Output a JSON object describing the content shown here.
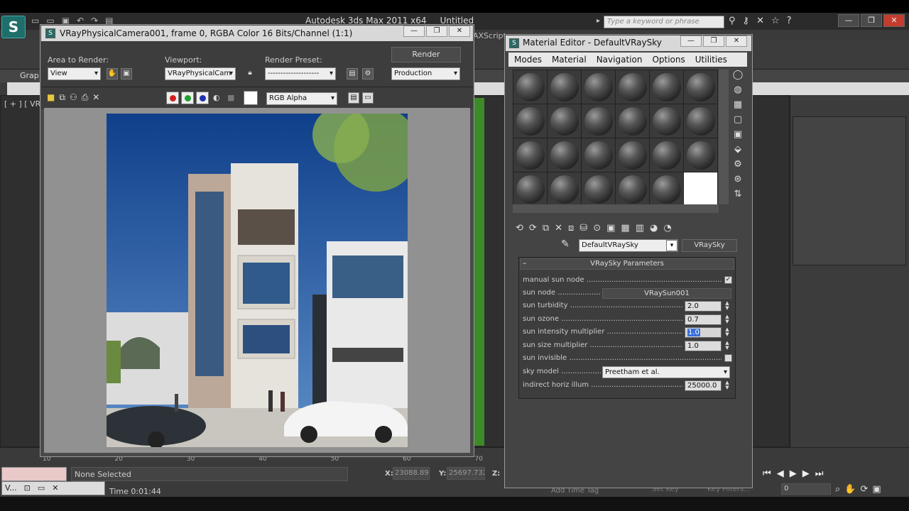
{
  "app": {
    "title": "Autodesk 3ds Max 2011 x64",
    "doc": "Untitled",
    "search_placeholder": "Type a keyword or phrase",
    "ribbon_tab": "Grap",
    "viewport_label": "[ + ] [ VR",
    "maxscript_label": "AXScript"
  },
  "render_window": {
    "title": "VRayPhysicalCamera001, frame 0, RGBA Color 16 Bits/Channel (1:1)",
    "area_label": "Area to Render:",
    "area_value": "View",
    "viewport_label": "Viewport:",
    "viewport_value": "VRayPhysicalCam",
    "preset_label": "Render Preset:",
    "preset_value": "--------------------",
    "render_button": "Render",
    "production_value": "Production",
    "channel_value": "RGB Alpha"
  },
  "material_editor": {
    "title": "Material Editor - DefaultVRaySky",
    "menu": [
      "Modes",
      "Material",
      "Navigation",
      "Options",
      "Utilities"
    ],
    "material_name": "DefaultVRaySky",
    "material_type": "VRaySky",
    "rollout_title": "VRaySky Parameters",
    "params": {
      "manual_sun_node": {
        "label": "manual sun node",
        "checked": true
      },
      "sun_node": {
        "label": "sun node",
        "value": "VRaySun001"
      },
      "sun_turbidity": {
        "label": "sun turbidity",
        "value": "2.0"
      },
      "sun_ozone": {
        "label": "sun ozone",
        "value": "0.7"
      },
      "sun_intensity_multiplier": {
        "label": "sun intensity multiplier",
        "value": "1.0"
      },
      "sun_size_multiplier": {
        "label": "sun size multiplier",
        "value": "1.0"
      },
      "sun_invisible": {
        "label": "sun invisible",
        "checked": false
      },
      "sky_model": {
        "label": "sky model",
        "value": "Preetham et al."
      },
      "indirect_horiz_illum": {
        "label": "indirect horiz illum",
        "value": "25000.0"
      }
    }
  },
  "timeline": {
    "ticks": [
      "10",
      "20",
      "30",
      "40",
      "50",
      "60",
      "70"
    ]
  },
  "status": {
    "selection": "None Selected",
    "time": "Time  0:01:44",
    "x_label": "X:",
    "x_value": "23088.895",
    "y_label": "Y:",
    "y_value": "25697.732",
    "z_label": "Z:",
    "add_time_tag": "Add Time Tag",
    "set_key": "Set Key",
    "key_filters": "Key Filters...",
    "frame": "0",
    "task_label": "V..."
  }
}
